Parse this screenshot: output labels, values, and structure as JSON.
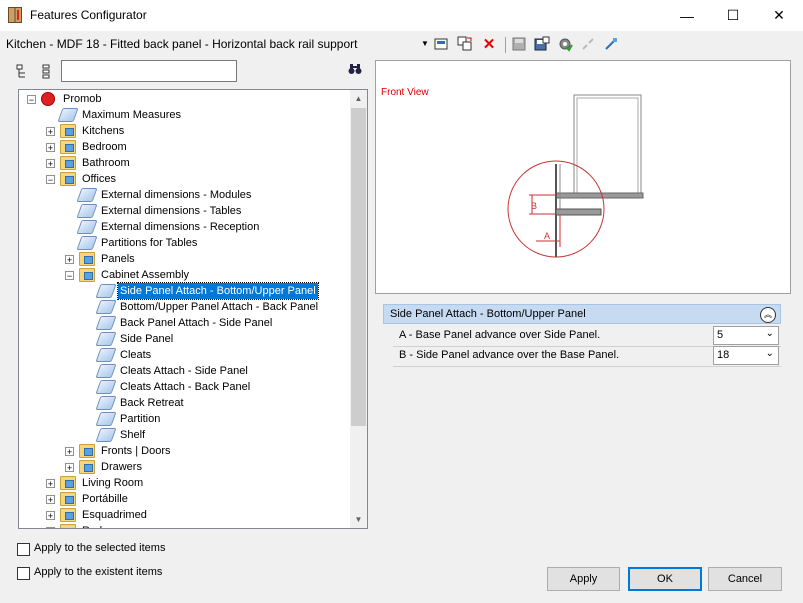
{
  "window": {
    "title": "Features Configurator",
    "minimize_glyph": "—",
    "maximize_glyph": "☐",
    "close_glyph": "✕"
  },
  "toolbar": {
    "current_config": "Kitchen - MDF 18 - Fitted back panel - Horizontal back rail support",
    "icons": [
      "new-item-icon",
      "replace-icon",
      "delete-icon",
      "save-icon",
      "save-as-icon",
      "settings-icon",
      "disconnect-icon",
      "connect-icon"
    ]
  },
  "search": {
    "value": "",
    "placeholder": ""
  },
  "tree": {
    "items": [
      {
        "label": "Promob"
      },
      {
        "label": "Maximum Measures"
      },
      {
        "label": "Kitchens"
      },
      {
        "label": "Bedroom"
      },
      {
        "label": "Bathroom"
      },
      {
        "label": "Offices"
      },
      {
        "label": "External dimensions - Modules"
      },
      {
        "label": "External dimensions - Tables"
      },
      {
        "label": "External dimensions - Reception"
      },
      {
        "label": "Partitions for Tables"
      },
      {
        "label": "Panels"
      },
      {
        "label": "Cabinet Assembly"
      },
      {
        "label": "Side Panel Attach - Bottom/Upper Panel"
      },
      {
        "label": "Bottom/Upper Panel Attach - Back Panel"
      },
      {
        "label": "Back Panel Attach - Side Panel"
      },
      {
        "label": "Side Panel"
      },
      {
        "label": "Cleats"
      },
      {
        "label": "Cleats Attach - Side Panel"
      },
      {
        "label": "Cleats Attach - Back Panel"
      },
      {
        "label": "Back Retreat"
      },
      {
        "label": "Partition"
      },
      {
        "label": "Shelf"
      },
      {
        "label": "Fronts | Doors"
      },
      {
        "label": "Drawers"
      },
      {
        "label": "Living Room"
      },
      {
        "label": "Portábille"
      },
      {
        "label": "Esquadrimed"
      },
      {
        "label": "Rodapes"
      }
    ]
  },
  "preview": {
    "view_label": "Front View",
    "dim_a": "A",
    "dim_b": "B",
    "accent_color": "#c83232"
  },
  "properties": {
    "group_title": "Side Panel Attach - Bottom/Upper Panel",
    "rows": [
      {
        "label": "A - Base Panel advance over Side Panel.",
        "value": "5"
      },
      {
        "label": "B - Side Panel advance over the Base Panel.",
        "value": "18"
      }
    ]
  },
  "options": {
    "apply_selected": "Apply to the selected items",
    "apply_existent": "Apply to the existent items"
  },
  "buttons": {
    "apply": "Apply",
    "ok": "OK",
    "cancel": "Cancel"
  }
}
